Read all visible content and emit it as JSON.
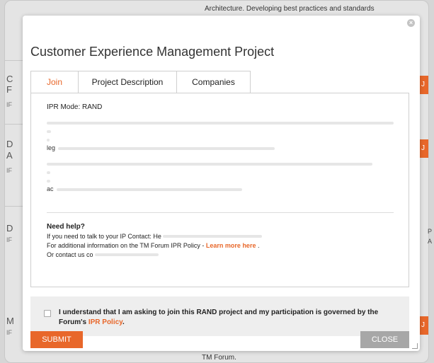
{
  "background": {
    "top_text": "Architecture. Developing best practices and standards",
    "bottom_text": "TM Forum.",
    "letters": [
      "C",
      "F",
      "IF",
      "D",
      "A",
      "IF",
      "D",
      "IF",
      "M",
      "IF"
    ],
    "right_letters": [
      "P",
      "A"
    ],
    "orange_tab_glyph": "J"
  },
  "modal": {
    "title": "Customer Experience Management Project",
    "close_glyph": "×",
    "tabs": [
      {
        "label": "Join"
      },
      {
        "label": "Project Description"
      },
      {
        "label": "Companies"
      }
    ],
    "ipr_mode": "IPR Mode:  RAND",
    "blurred_prefixes": [
      "leg",
      "ac"
    ],
    "help": {
      "title": "Need help?",
      "line1": "If you need to talk to your IP Contact: He",
      "line2_prefix": "For additional information on the TM Forum IPR Policy - ",
      "line2_link": "Learn more here",
      "line2_suffix": " .",
      "line3": "Or contact us co"
    },
    "agreement": {
      "text": "I understand that I am asking to join this RAND project and my participation is governed by the Forum's ",
      "link": "IPR Policy",
      "suffix": "."
    },
    "submit_label": "SUBMIT",
    "close_label": "CLOSE"
  }
}
